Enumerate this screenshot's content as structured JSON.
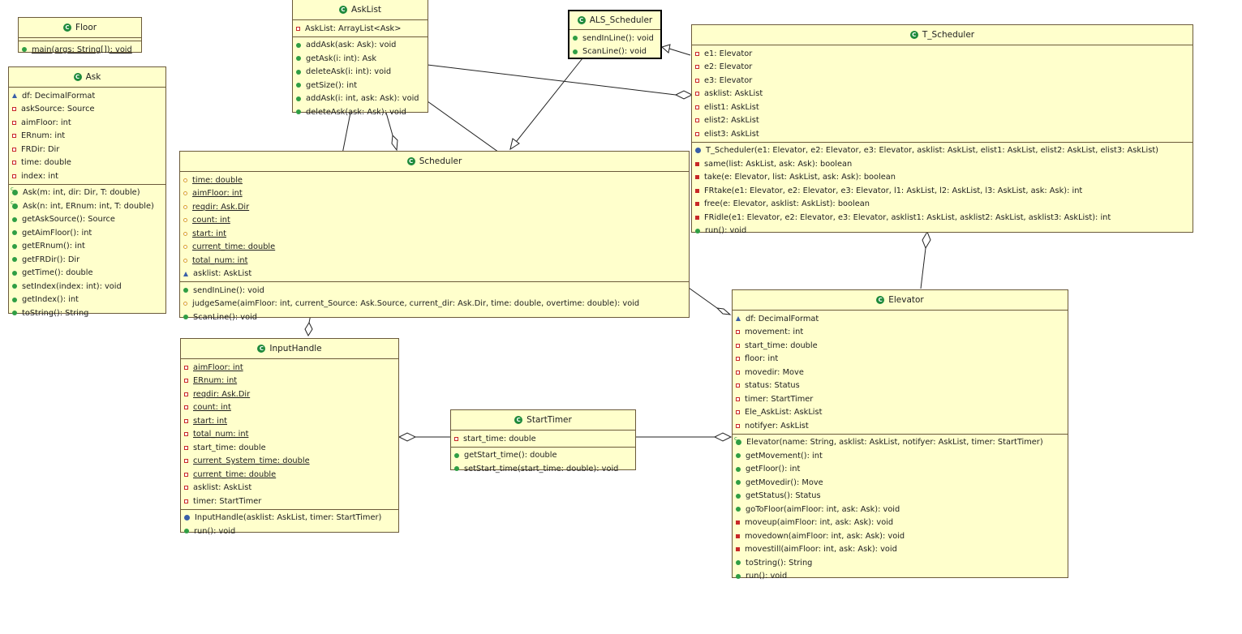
{
  "classes": {
    "floor": {
      "name": "Floor",
      "methods": [
        {
          "vis": "pub",
          "text": "main(args: String[]): void",
          "static": true
        }
      ]
    },
    "ask": {
      "name": "Ask",
      "attributes": [
        {
          "vis": "pkg",
          "text": "df: DecimalFormat"
        },
        {
          "vis": "priv",
          "text": "askSource: Source"
        },
        {
          "vis": "priv",
          "text": "aimFloor: int"
        },
        {
          "vis": "priv",
          "text": "ERnum: int"
        },
        {
          "vis": "priv",
          "text": "FRDir: Dir"
        },
        {
          "vis": "priv",
          "text": "time: double"
        },
        {
          "vis": "priv",
          "text": "index: int"
        }
      ],
      "methods": [
        {
          "vis": "ctor",
          "text": "Ask(m: int, dir: Dir, T: double)"
        },
        {
          "vis": "ctor",
          "text": "Ask(n: int, ERnum: int, T: double)"
        },
        {
          "vis": "pub",
          "text": "getAskSource(): Source"
        },
        {
          "vis": "pub",
          "text": "getAimFloor(): int"
        },
        {
          "vis": "pub",
          "text": "getERnum(): int"
        },
        {
          "vis": "pub",
          "text": "getFRDir(): Dir"
        },
        {
          "vis": "pub",
          "text": "getTime(): double"
        },
        {
          "vis": "pub",
          "text": "setIndex(index: int): void"
        },
        {
          "vis": "pub",
          "text": "getIndex(): int"
        },
        {
          "vis": "pub",
          "text": "toString(): String"
        }
      ]
    },
    "asklist": {
      "name": "AskList",
      "attributes": [
        {
          "vis": "priv",
          "text": "AskList: ArrayList<Ask>"
        }
      ],
      "methods": [
        {
          "vis": "pub",
          "text": "addAsk(ask: Ask): void"
        },
        {
          "vis": "pub",
          "text": "getAsk(i: int): Ask"
        },
        {
          "vis": "pub",
          "text": "deleteAsk(i: int): void"
        },
        {
          "vis": "pub",
          "text": "getSize(): int"
        },
        {
          "vis": "pub",
          "text": "addAsk(i: int, ask: Ask): void"
        },
        {
          "vis": "pub",
          "text": "deleteAsk(ask: Ask): void"
        }
      ]
    },
    "als": {
      "name": "ALS_Scheduler",
      "methods": [
        {
          "vis": "pub",
          "text": "sendInLine(): void"
        },
        {
          "vis": "pub",
          "text": "ScanLine(): void"
        }
      ]
    },
    "tsched": {
      "name": "T_Scheduler",
      "attributes": [
        {
          "vis": "priv",
          "text": "e1: Elevator"
        },
        {
          "vis": "priv",
          "text": "e2: Elevator"
        },
        {
          "vis": "priv",
          "text": "e3: Elevator"
        },
        {
          "vis": "priv",
          "text": "asklist: AskList"
        },
        {
          "vis": "priv",
          "text": "elist1: AskList"
        },
        {
          "vis": "priv",
          "text": "elist2: AskList"
        },
        {
          "vis": "priv",
          "text": "elist3: AskList"
        }
      ],
      "methods": [
        {
          "vis": "ctorpkg",
          "text": "T_Scheduler(e1: Elevator, e2: Elevator, e3: Elevator, asklist: AskList, elist1: AskList, elist2: AskList, elist3: AskList)"
        },
        {
          "vis": "privm",
          "text": "same(list: AskList, ask: Ask): boolean"
        },
        {
          "vis": "privm",
          "text": "take(e: Elevator, list: AskList, ask: Ask): boolean"
        },
        {
          "vis": "privm",
          "text": "FRtake(e1: Elevator, e2: Elevator, e3: Elevator, l1: AskList, l2: AskList, l3: AskList, ask: Ask): int"
        },
        {
          "vis": "privm",
          "text": "free(e: Elevator, asklist: AskList): boolean"
        },
        {
          "vis": "privm",
          "text": "FRidle(e1: Elevator, e2: Elevator, e3: Elevator, asklist1: AskList, asklist2: AskList, asklist3: AskList): int"
        },
        {
          "vis": "pub",
          "text": "run(): void"
        }
      ]
    },
    "scheduler": {
      "name": "Scheduler",
      "attributes": [
        {
          "vis": "stat",
          "text": "time: double",
          "static": true
        },
        {
          "vis": "stat",
          "text": "aimFloor: int",
          "static": true
        },
        {
          "vis": "stat",
          "text": "reqdir: Ask.Dir",
          "static": true
        },
        {
          "vis": "stat",
          "text": "count: int",
          "static": true
        },
        {
          "vis": "stat",
          "text": "start: int",
          "static": true
        },
        {
          "vis": "stat",
          "text": "current_time: double",
          "static": true
        },
        {
          "vis": "stat",
          "text": "total_num: int",
          "static": true
        },
        {
          "vis": "pkg",
          "text": "asklist: AskList"
        }
      ],
      "methods": [
        {
          "vis": "pub",
          "text": "sendInLine(): void"
        },
        {
          "vis": "stat",
          "text": "judgeSame(aimFloor: int, current_Source: Ask.Source, current_dir: Ask.Dir, time: double, overtime: double): void"
        },
        {
          "vis": "pub",
          "text": "ScanLine(): void"
        }
      ]
    },
    "inputhandle": {
      "name": "InputHandle",
      "attributes": [
        {
          "vis": "priv",
          "text": "aimFloor: int",
          "static": true
        },
        {
          "vis": "priv",
          "text": "ERnum: int",
          "static": true
        },
        {
          "vis": "priv",
          "text": "reqdir: Ask.Dir",
          "static": true
        },
        {
          "vis": "priv",
          "text": "count: int",
          "static": true
        },
        {
          "vis": "priv",
          "text": "start: int",
          "static": true
        },
        {
          "vis": "priv",
          "text": "total_num: int",
          "static": true
        },
        {
          "vis": "priv",
          "text": "start_time: double"
        },
        {
          "vis": "priv",
          "text": "current_System_time: double",
          "static": true
        },
        {
          "vis": "priv",
          "text": "current_time: double",
          "static": true
        },
        {
          "vis": "priv",
          "text": "asklist: AskList"
        },
        {
          "vis": "priv",
          "text": "timer: StartTimer"
        }
      ],
      "methods": [
        {
          "vis": "ctorpkg",
          "text": "InputHandle(asklist: AskList, timer: StartTimer)"
        },
        {
          "vis": "pub",
          "text": "run(): void"
        }
      ]
    },
    "starttimer": {
      "name": "StartTimer",
      "attributes": [
        {
          "vis": "priv",
          "text": "start_time: double"
        }
      ],
      "methods": [
        {
          "vis": "pub",
          "text": "getStart_time(): double"
        },
        {
          "vis": "pub",
          "text": "setStart_time(start_time: double): void"
        }
      ]
    },
    "elevator": {
      "name": "Elevator",
      "attributes": [
        {
          "vis": "pkg",
          "text": "df: DecimalFormat"
        },
        {
          "vis": "priv",
          "text": "movement: int"
        },
        {
          "vis": "priv",
          "text": "start_time: double"
        },
        {
          "vis": "priv",
          "text": "floor: int"
        },
        {
          "vis": "priv",
          "text": "movedir: Move"
        },
        {
          "vis": "priv",
          "text": "status: Status"
        },
        {
          "vis": "priv",
          "text": "timer: StartTimer"
        },
        {
          "vis": "priv",
          "text": "Ele_AskList: AskList"
        },
        {
          "vis": "priv",
          "text": "notifyer: AskList"
        }
      ],
      "methods": [
        {
          "vis": "ctor",
          "text": "Elevator(name: String, asklist: AskList, notifyer: AskList, timer: StartTimer)"
        },
        {
          "vis": "pub",
          "text": "getMovement(): int"
        },
        {
          "vis": "pub",
          "text": "getFloor(): int"
        },
        {
          "vis": "pub",
          "text": "getMovedir(): Move"
        },
        {
          "vis": "pub",
          "text": "getStatus(): Status"
        },
        {
          "vis": "pub",
          "text": "goToFloor(aimFloor: int, ask: Ask): void"
        },
        {
          "vis": "privm",
          "text": "moveup(aimFloor: int, ask: Ask): void"
        },
        {
          "vis": "privm",
          "text": "movedown(aimFloor: int, ask: Ask): void"
        },
        {
          "vis": "privm",
          "text": "movestill(aimFloor: int, ask: Ask): void"
        },
        {
          "vis": "pub",
          "text": "toString(): String"
        },
        {
          "vis": "pub",
          "text": "run(): void"
        }
      ]
    }
  }
}
